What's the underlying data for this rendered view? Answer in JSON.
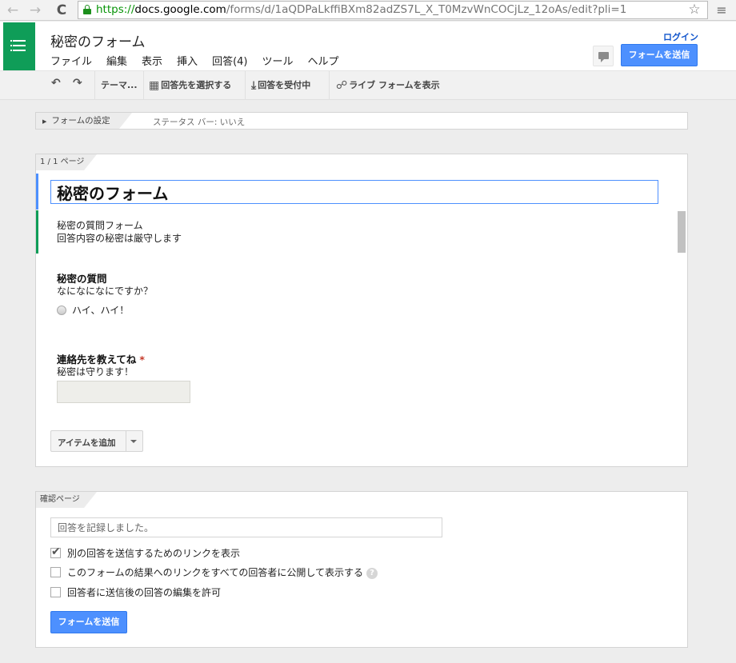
{
  "browser": {
    "url_scheme": "https://",
    "url_host": "docs.google.com",
    "url_path": "/forms/d/1aQDPaLkffiBXm82adZS7L_X_T0MzvWnCOCjLz_12oAs/edit?pli=1",
    "back_icon": "←",
    "forward_icon": "→",
    "reload_icon": "C",
    "star_icon": "☆",
    "menu_icon": "≡"
  },
  "header": {
    "title": "秘密のフォーム",
    "login": "ログイン",
    "send_label": "フォームを送信",
    "menu": [
      "ファイル",
      "編集",
      "表示",
      "挿入",
      "回答(4)",
      "ツール",
      "ヘルプ"
    ]
  },
  "toolbar": {
    "undo_icon": "↶",
    "redo_icon": "↷",
    "theme": "テーマ...",
    "destination": "回答先を選択する",
    "accepting": "回答を受付中",
    "live": "ライブ フォームを表示"
  },
  "settings": {
    "label": "フォームの設定",
    "status": "ステータス バー: いいえ",
    "arrow": "▶"
  },
  "form": {
    "page_label": "1 / 1 ページ",
    "title": "秘密のフォーム",
    "description_line1": "秘密の質問フォーム",
    "description_line2": "回答内容の秘密は厳守します",
    "questions": [
      {
        "title": "秘密の質問",
        "help": "なになになにですか？",
        "option": "ハイ、ハイ！"
      },
      {
        "title": "連絡先を教えてね",
        "required_mark": "*",
        "help": "秘密は守ります！"
      }
    ],
    "add_item": "アイテムを追加"
  },
  "confirmation": {
    "page_label": "確認ページ",
    "message": "回答を記録しました。",
    "options": [
      {
        "label": "別の回答を送信するためのリンクを表示",
        "checked": true
      },
      {
        "label": "このフォームの結果へのリンクをすべての回答者に公開して表示する",
        "checked": false
      },
      {
        "label": "回答者に送信後の回答の編集を許可",
        "checked": false
      }
    ],
    "tick": "✔",
    "help_mark": "?",
    "send_label": "フォームを送信"
  },
  "colors": {
    "accent_blue": "#4d90fe",
    "forms_green": "#0f9d58",
    "required_red": "#c53929"
  }
}
